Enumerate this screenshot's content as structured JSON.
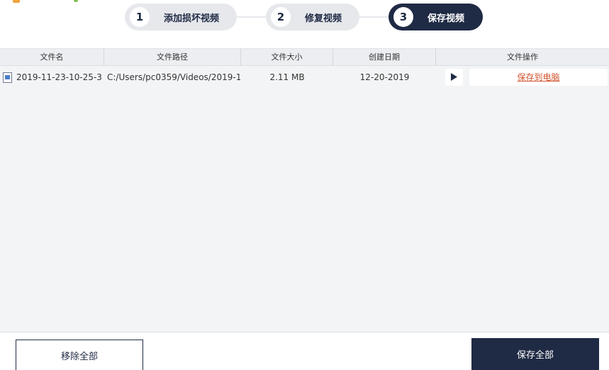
{
  "steps": [
    {
      "num": "1",
      "label": "添加损坏视频",
      "active": false
    },
    {
      "num": "2",
      "label": "修复视频",
      "active": false
    },
    {
      "num": "3",
      "label": "保存视频",
      "active": true
    }
  ],
  "table": {
    "headers": {
      "name": "文件名",
      "path": "文件路径",
      "size": "文件大小",
      "date": "创建日期",
      "actions": "文件操作"
    },
    "rows": [
      {
        "name": "2019-11-23-10-25-3...",
        "path": "C:/Users/pc0359/Videos/2019-1...",
        "size": "2.11  MB",
        "date": "12-20-2019",
        "save_label": "保存到电脑",
        "icon": "video-file-icon"
      }
    ]
  },
  "footer": {
    "remove_all": "移除全部",
    "save_all": "保存全部"
  },
  "colors": {
    "primary": "#1f2a44",
    "link": "#d2542f",
    "background": "#f3f4f6"
  }
}
